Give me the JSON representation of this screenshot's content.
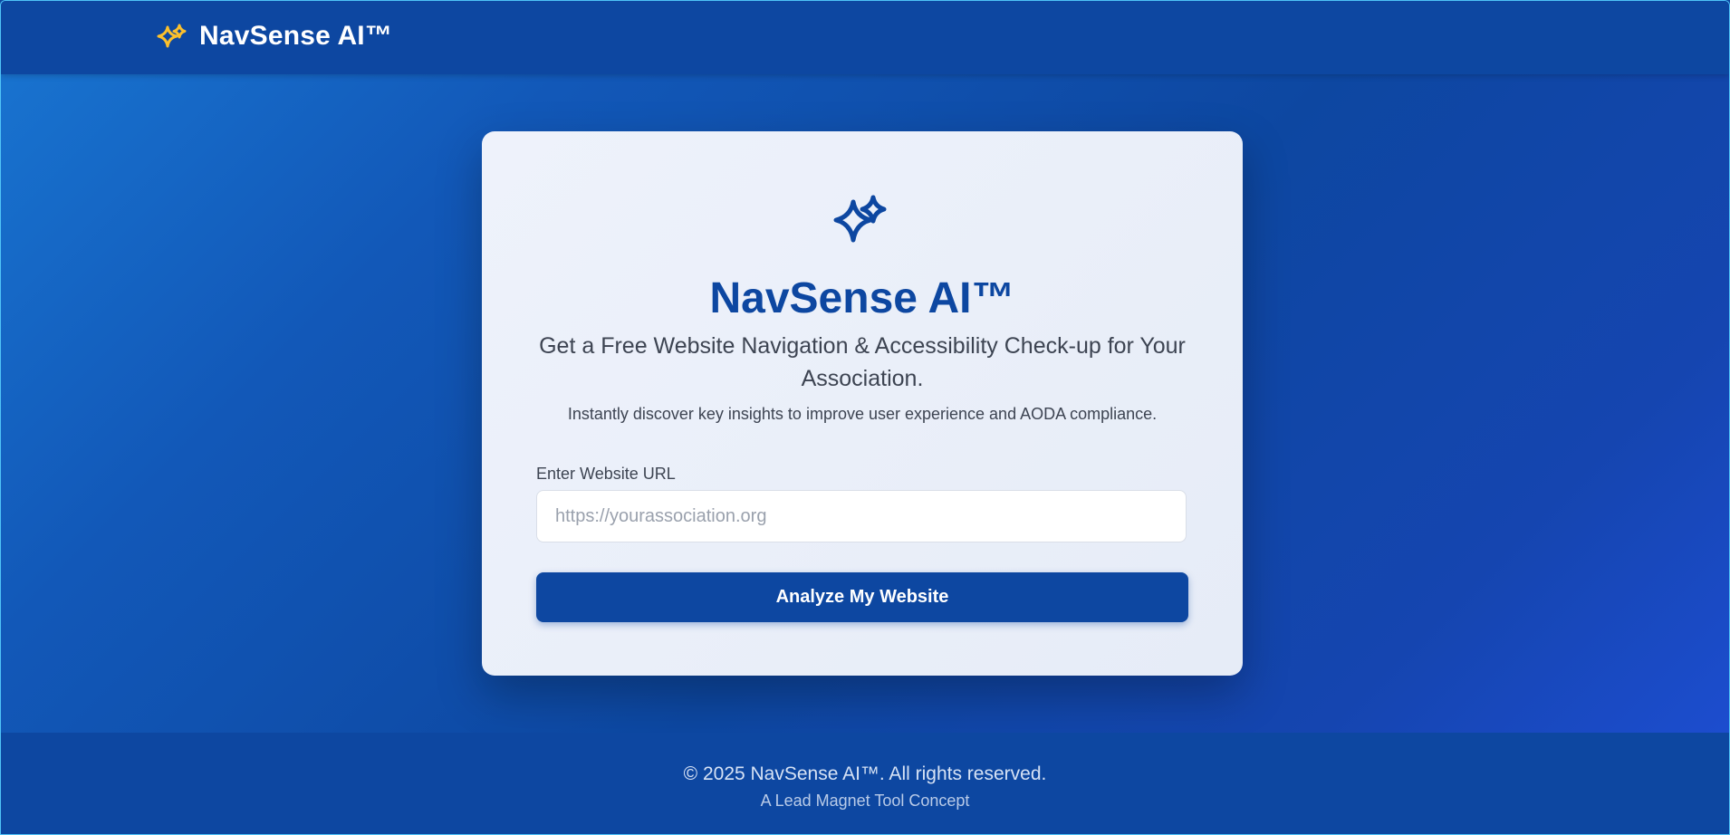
{
  "header": {
    "brand_name": "NavSense AI™",
    "brand_icon": "sparkles-icon",
    "brand_icon_color": "#fbc02d"
  },
  "card": {
    "icon": "sparkles-icon",
    "title": "NavSense AI™",
    "subtitle": "Get a Free Website Navigation & Accessibility Check-up for Your Association.",
    "description": "Instantly discover key insights to improve user experience and AODA compliance.",
    "url_field": {
      "label": "Enter Website URL",
      "placeholder": "https://yourassociation.org",
      "value": ""
    },
    "submit_label": "Analyze My Website"
  },
  "footer": {
    "copyright": "© 2025 NavSense AI™. All rights reserved.",
    "tagline": "A Lead Magnet Tool Concept"
  },
  "colors": {
    "primary": "#0d47a1",
    "accent": "#fbc02d",
    "card_bg": "#e8eef9",
    "text": "#3d4452"
  }
}
